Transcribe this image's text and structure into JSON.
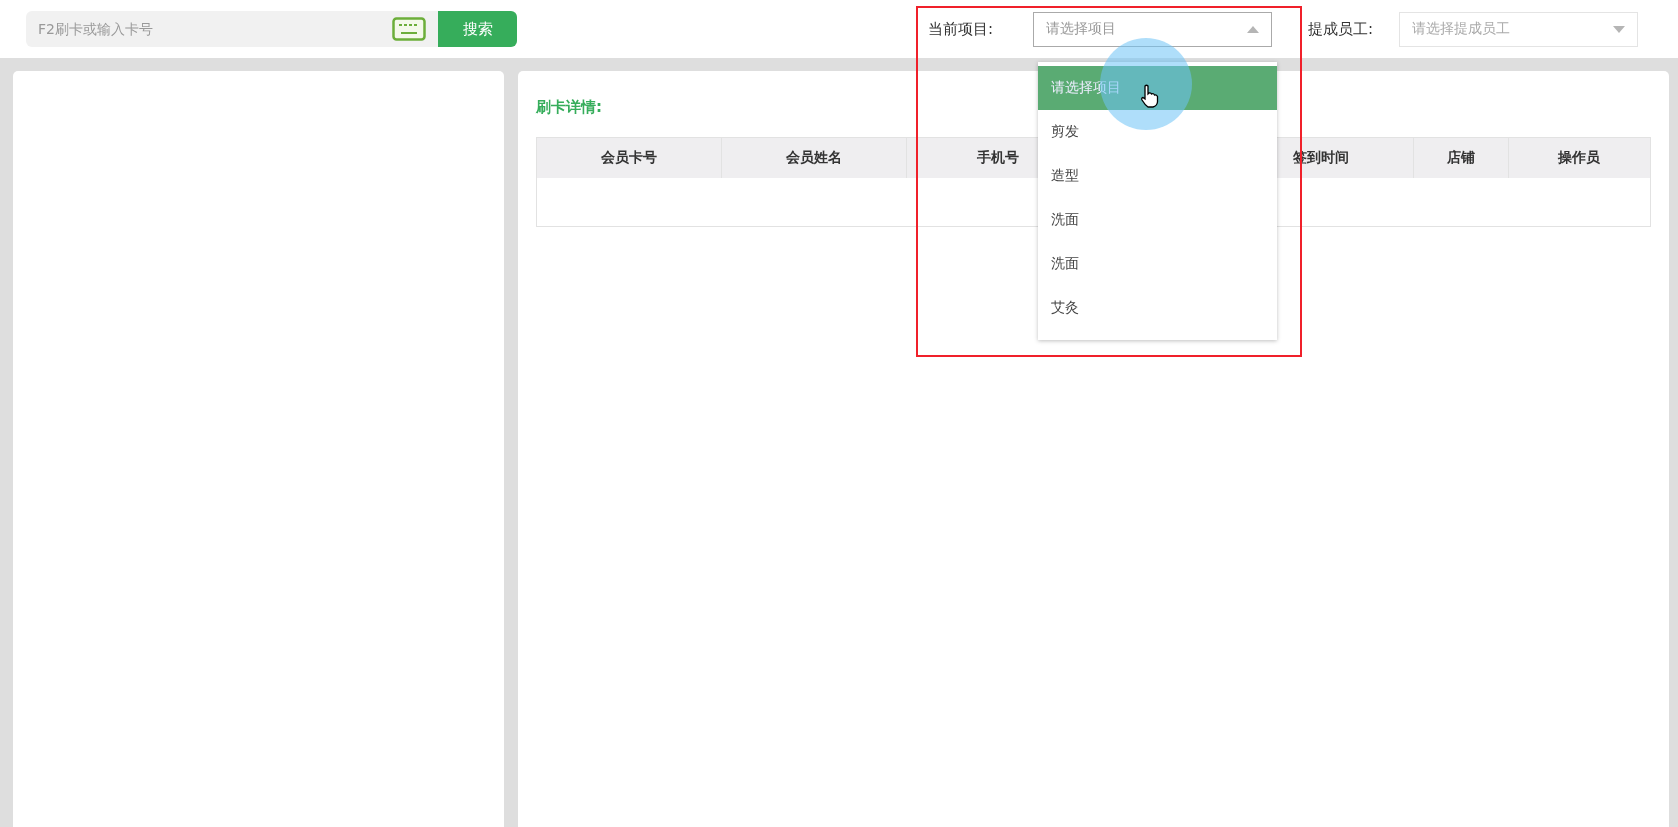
{
  "search": {
    "placeholder": "F2刷卡或输入卡号",
    "button": "搜索"
  },
  "project_select": {
    "label": "当前项目:",
    "placeholder": "请选择项目",
    "expanded": true,
    "options": [
      {
        "label": "请选择项目",
        "selected": true
      },
      {
        "label": "剪发",
        "selected": false
      },
      {
        "label": "造型",
        "selected": false
      },
      {
        "label": "洗面",
        "selected": false
      },
      {
        "label": "洗面",
        "selected": false
      },
      {
        "label": "艾灸",
        "selected": false
      }
    ]
  },
  "staff_select": {
    "label": "提成员工:",
    "placeholder": "请选择提成员工",
    "expanded": false
  },
  "details": {
    "title": "刷卡详情:",
    "columns": [
      "会员卡号",
      "会员姓名",
      "手机号",
      "",
      "签到时间",
      "店铺",
      "操作员"
    ]
  }
}
